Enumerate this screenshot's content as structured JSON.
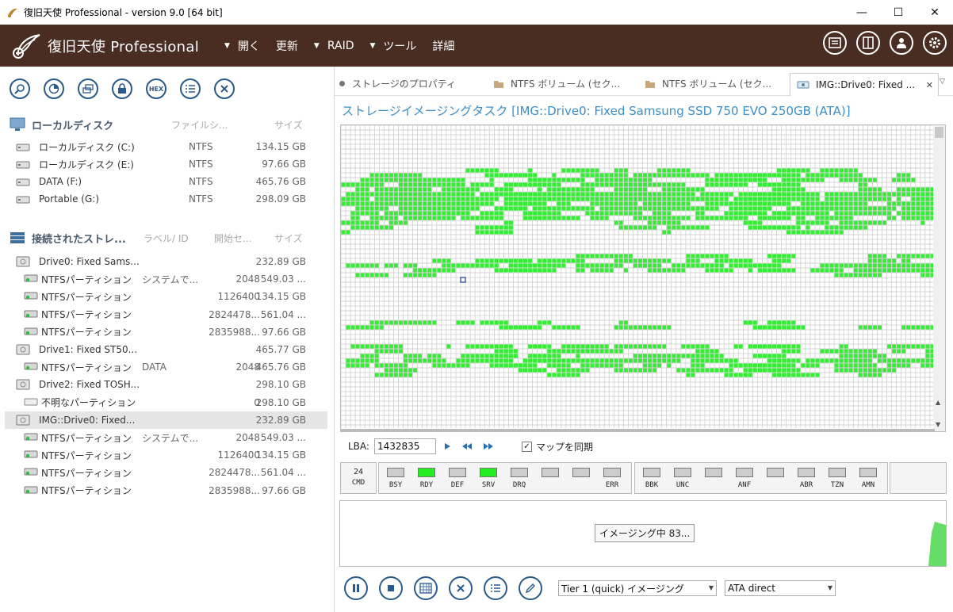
{
  "window": {
    "title": "復旧天使 Professional - version 9.0 [64 bit]",
    "minimize": "—",
    "maximize": "☐",
    "close": "✕"
  },
  "appbar": {
    "brand": "復旧天使 Professional",
    "menu": [
      {
        "label": "開く",
        "has_dropdown": true
      },
      {
        "label": "更新",
        "has_dropdown": false
      },
      {
        "label": "RAID",
        "has_dropdown": true
      },
      {
        "label": "ツール",
        "has_dropdown": true
      },
      {
        "label": "詳細",
        "has_dropdown": false
      }
    ],
    "right_icons": [
      "log-icon",
      "panel-icon",
      "user-icon",
      "settings-icon"
    ]
  },
  "left_toolbar": {
    "buttons": [
      "search-icon",
      "scan-icon",
      "copy-icon",
      "lock-icon",
      "hex-icon",
      "list-icon",
      "close-icon"
    ],
    "hex_label": "HEX"
  },
  "local_disks": {
    "header": "ローカルディスク",
    "col_fs": "ファイルシ...",
    "col_size": "サイズ",
    "items": [
      {
        "name": "ローカルディスク (C:)",
        "fs": "NTFS",
        "size": "134.15 GB"
      },
      {
        "name": "ローカルディスク (E:)",
        "fs": "NTFS",
        "size": "97.66 GB"
      },
      {
        "name": "DATA (F:)",
        "fs": "NTFS",
        "size": "465.76 GB"
      },
      {
        "name": "Portable (G:)",
        "fs": "NTFS",
        "size": "298.09 GB"
      }
    ]
  },
  "connected_storage": {
    "header": "接続されたストレ...",
    "col_label": "ラベル/ ID",
    "col_start": "開始セ...",
    "col_size": "サイズ",
    "items": [
      {
        "type": "drive",
        "name": "Drive0: Fixed Sams...",
        "label": "",
        "start": "",
        "size": "232.89 GB"
      },
      {
        "type": "part",
        "name": "NTFSパーティション",
        "label": "システムで...",
        "start": "2048",
        "size": "549.03 ..."
      },
      {
        "type": "part",
        "name": "NTFSパーティション",
        "label": "",
        "start": "1126400",
        "size": "134.15 GB"
      },
      {
        "type": "part",
        "name": "NTFSパーティション",
        "label": "",
        "start": "2824478...",
        "size": "561.04 ..."
      },
      {
        "type": "part",
        "name": "NTFSパーティション",
        "label": "",
        "start": "2835988...",
        "size": "97.66 GB"
      },
      {
        "type": "drive",
        "name": "Drive1: Fixed ST50...",
        "label": "",
        "start": "",
        "size": "465.77 GB"
      },
      {
        "type": "part",
        "name": "NTFSパーティション",
        "label": "DATA",
        "start": "2048",
        "size": "465.76 GB"
      },
      {
        "type": "drive",
        "name": "Drive2: Fixed TOSH...",
        "label": "",
        "start": "",
        "size": "298.10 GB"
      },
      {
        "type": "unknown",
        "name": "不明なパーティション",
        "label": "",
        "start": "0",
        "size": "298.10 GB"
      },
      {
        "type": "drive",
        "name": "IMG::Drive0: Fixed...",
        "label": "",
        "start": "",
        "size": "232.89 GB",
        "selected": true
      },
      {
        "type": "part",
        "name": "NTFSパーティション",
        "label": "システムで...",
        "start": "2048",
        "size": "549.03 ..."
      },
      {
        "type": "part",
        "name": "NTFSパーティション",
        "label": "",
        "start": "1126400",
        "size": "134.15 GB"
      },
      {
        "type": "part",
        "name": "NTFSパーティション",
        "label": "",
        "start": "2824478...",
        "size": "561.04 ..."
      },
      {
        "type": "part",
        "name": "NTFSパーティション",
        "label": "",
        "start": "2835988...",
        "size": "97.66 GB"
      }
    ]
  },
  "tabs": [
    {
      "label": "ストレージのプロパティ",
      "icon": "dot-icon"
    },
    {
      "label": "NTFS ボリューム (セク...",
      "icon": "folder-icon"
    },
    {
      "label": "NTFS ボリューム (セク...",
      "icon": "folder-icon"
    },
    {
      "label": "IMG::Drive0: Fixed ...",
      "icon": "drive-icon",
      "active": true
    }
  ],
  "tab_close": "✕",
  "task": {
    "title": "ストレージイメージングタスク [IMG::Drive0: Fixed Samsung SSD 750 EVO 250GB (ATA)]",
    "lba_label": "LBA:",
    "lba_value": "1432835",
    "sync_label": "マップを同期",
    "sync_checked": true
  },
  "registers": {
    "cmd_value": "24",
    "cmd_label": "CMD",
    "group1": [
      {
        "label": "BSY",
        "on": false
      },
      {
        "label": "RDY",
        "on": true
      },
      {
        "label": "DEF",
        "on": false
      },
      {
        "label": "SRV",
        "on": true
      },
      {
        "label": "DRQ",
        "on": false
      },
      {
        "label": "",
        "on": false
      },
      {
        "label": "",
        "on": false
      },
      {
        "label": "ERR",
        "on": false
      }
    ],
    "group2": [
      {
        "label": "BBK",
        "on": false
      },
      {
        "label": "UNC",
        "on": false
      },
      {
        "label": "",
        "on": false
      },
      {
        "label": "ANF",
        "on": false
      },
      {
        "label": "",
        "on": false
      },
      {
        "label": "ABR",
        "on": false
      },
      {
        "label": "TZN",
        "on": false
      },
      {
        "label": "AMN",
        "on": false
      }
    ]
  },
  "progress_label": "イメージング中 83...",
  "bottom": {
    "buttons": [
      "pause-icon",
      "stop-icon",
      "map-icon",
      "cancel-icon",
      "list-icon",
      "edit-icon"
    ],
    "mode": "Tier 1 (quick) イメージング",
    "method": "ATA direct"
  },
  "colors": {
    "appbar": "#4a2d22",
    "accent": "#3c8fc8",
    "block_green": "#33ee33",
    "icon_blue": "#2a5a8c"
  }
}
